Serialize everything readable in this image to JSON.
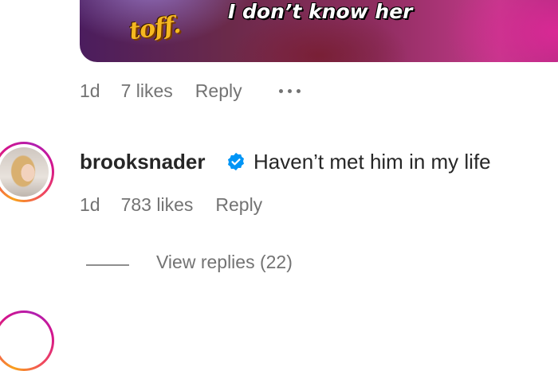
{
  "gif": {
    "logo_text": "toff.",
    "caption": "I don’t know her"
  },
  "prev_comment": {
    "time": "1d",
    "likes": "7 likes",
    "reply_label": "Reply"
  },
  "comment": {
    "username": "brooksnader",
    "verified": true,
    "text": "Haven’t met him in my life",
    "time": "1d",
    "likes": "783 likes",
    "reply_label": "Reply"
  },
  "replies": {
    "label": "View replies (22)"
  },
  "colors": {
    "meta_text": "#737373",
    "primary_text": "#262626",
    "verified_blue": "#0095f6"
  }
}
